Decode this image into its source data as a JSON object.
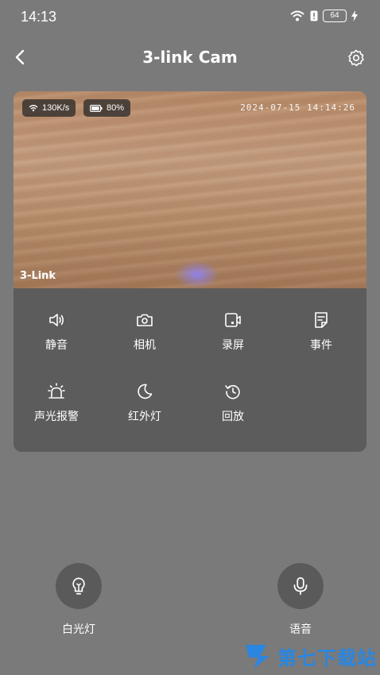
{
  "status_bar": {
    "time": "14:13",
    "battery": "64"
  },
  "header": {
    "title": "3-link Cam"
  },
  "video": {
    "speed": "130K/s",
    "battery": "80%",
    "timestamp": "2024-07-15 14:14:26",
    "brand": "3-Link"
  },
  "controls": [
    {
      "label": "静音",
      "icon": "speaker-icon"
    },
    {
      "label": "相机",
      "icon": "camera-icon"
    },
    {
      "label": "录屏",
      "icon": "video-record-icon"
    },
    {
      "label": "事件",
      "icon": "event-icon"
    },
    {
      "label": "声光报警",
      "icon": "alarm-icon"
    },
    {
      "label": "红外灯",
      "icon": "moon-icon"
    },
    {
      "label": "回放",
      "icon": "playback-icon"
    }
  ],
  "bottom": {
    "light_label": "白光灯",
    "voice_label": "语音"
  },
  "watermark": {
    "text": "第七下载站"
  }
}
